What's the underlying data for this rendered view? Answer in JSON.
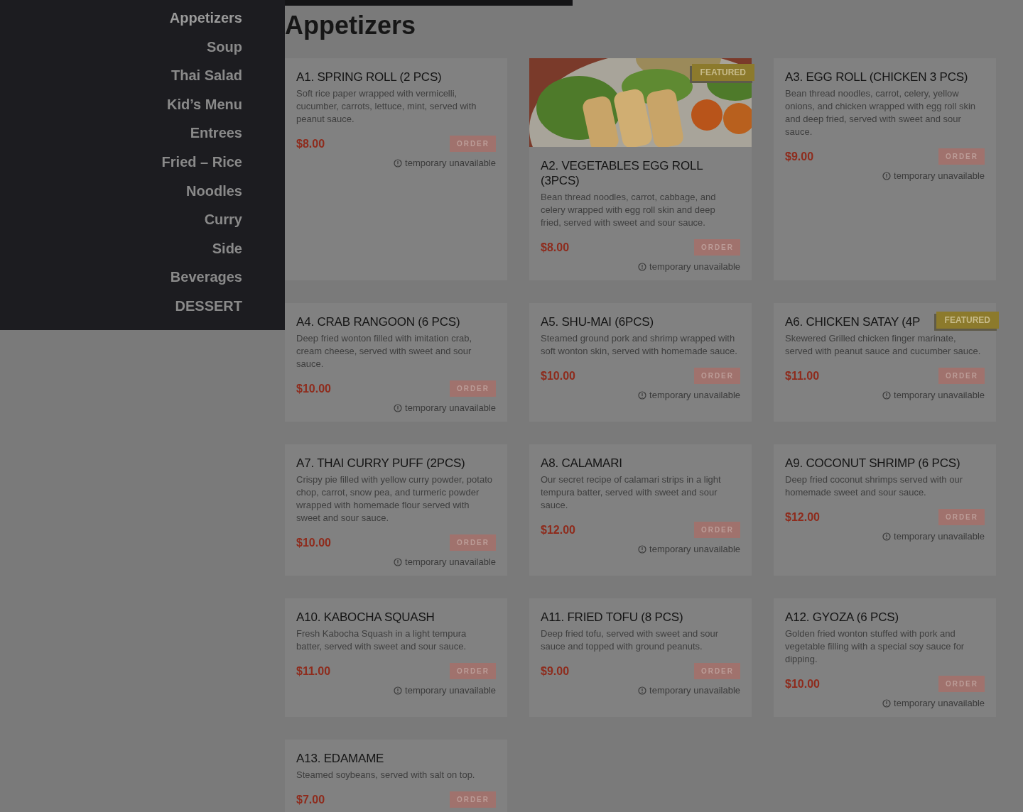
{
  "sidebar": {
    "items": [
      {
        "label": "Appetizers",
        "selected": true
      },
      {
        "label": "Soup",
        "selected": false
      },
      {
        "label": "Thai Salad",
        "selected": false
      },
      {
        "label": "Kid’s Menu",
        "selected": false
      },
      {
        "label": "Entrees",
        "selected": false
      },
      {
        "label": "Fried – Rice",
        "selected": false
      },
      {
        "label": "Noodles",
        "selected": false
      },
      {
        "label": "Curry",
        "selected": false
      },
      {
        "label": "Side",
        "selected": false
      },
      {
        "label": "Beverages",
        "selected": false
      },
      {
        "label": "DESSERT",
        "selected": false
      }
    ]
  },
  "section_title": "Appetizers",
  "items": [
    {
      "name": "A1. SPRING ROLL (2 PCS)",
      "description": "Soft rice paper wrapped with vermicelli, cucumber, carrots, lettuce, mint, served with peanut sauce.",
      "price": "$8.00",
      "order": "ORDER",
      "status": "temporary unavailable",
      "featured": false,
      "image": false
    },
    {
      "name": "A2. VEGETABLES EGG ROLL (3PCS)",
      "description": "Bean thread noodles, carrot, cabbage, and celery wrapped with egg roll skin and deep fried, served with sweet and sour sauce.",
      "price": "$8.00",
      "order": "ORDER",
      "status": "temporary unavailable",
      "featured": true,
      "featured_label": "FEATURED",
      "image": true
    },
    {
      "name": "A3. EGG ROLL (CHICKEN 3 PCS)",
      "description": "Bean thread noodles, carrot, celery, yellow onions, and chicken wrapped with egg roll skin and deep fried, served with sweet and sour sauce.",
      "price": "$9.00",
      "order": "ORDER",
      "status": "temporary unavailable",
      "featured": false,
      "image": false
    },
    {
      "name": "A4. CRAB RANGOON (6 PCS)",
      "description": "Deep fried wonton filled with imitation crab, cream cheese, served with sweet and sour sauce.",
      "price": "$10.00",
      "order": "ORDER",
      "status": "temporary unavailable",
      "featured": false,
      "image": false
    },
    {
      "name": "A5. SHU-MAI (6PCS)",
      "description": "Steamed ground pork and shrimp wrapped with soft wonton skin, served with homemade sauce.",
      "price": "$10.00",
      "order": "ORDER",
      "status": "temporary unavailable",
      "featured": false,
      "image": false
    },
    {
      "name": "A6. CHICKEN SATAY (4P",
      "description": "Skewered Grilled chicken finger marinate, served with peanut sauce and cucumber sauce.",
      "price": "$11.00",
      "order": "ORDER",
      "status": "temporary unavailable",
      "featured": true,
      "featured_label": "FEATURED",
      "image": false
    },
    {
      "name": "A7. THAI CURRY PUFF (2PCS)",
      "description": "Crispy pie filled with yellow curry powder, potato chop, carrot, snow pea, and turmeric powder wrapped with homemade flour served with sweet and sour sauce.",
      "price": "$10.00",
      "order": "ORDER",
      "status": "temporary unavailable",
      "featured": false,
      "image": false
    },
    {
      "name": "A8. CALAMARI",
      "description": "Our secret recipe of calamari strips in a light tempura batter, served with sweet and sour sauce.",
      "price": "$12.00",
      "order": "ORDER",
      "status": "temporary unavailable",
      "featured": false,
      "image": false
    },
    {
      "name": "A9. COCONUT SHRIMP (6 PCS)",
      "description": "Deep fried coconut shrimps served with our homemade sweet and sour sauce.",
      "price": "$12.00",
      "order": "ORDER",
      "status": "temporary unavailable",
      "featured": false,
      "image": false
    },
    {
      "name": "A10. KABOCHA SQUASH",
      "description": "Fresh Kabocha Squash in a light tempura batter, served with sweet and sour sauce.",
      "price": "$11.00",
      "order": "ORDER",
      "status": "temporary unavailable",
      "featured": false,
      "image": false
    },
    {
      "name": "A11. FRIED TOFU (8 PCS)",
      "description": "Deep fried tofu, served with sweet and sour sauce and topped with ground peanuts.",
      "price": "$9.00",
      "order": "ORDER",
      "status": "temporary unavailable",
      "featured": false,
      "image": false
    },
    {
      "name": "A12. GYOZA (6 PCS)",
      "description": "Golden fried wonton stuffed with pork and vegetable filling with a special soy sauce for dipping.",
      "price": "$10.00",
      "order": "ORDER",
      "status": "temporary unavailable",
      "featured": false,
      "image": false
    },
    {
      "name": "A13. EDAMAME",
      "description": "Steamed soybeans, served with salt on top.",
      "price": "$7.00",
      "order": "ORDER",
      "featured": false,
      "image": false
    }
  ]
}
